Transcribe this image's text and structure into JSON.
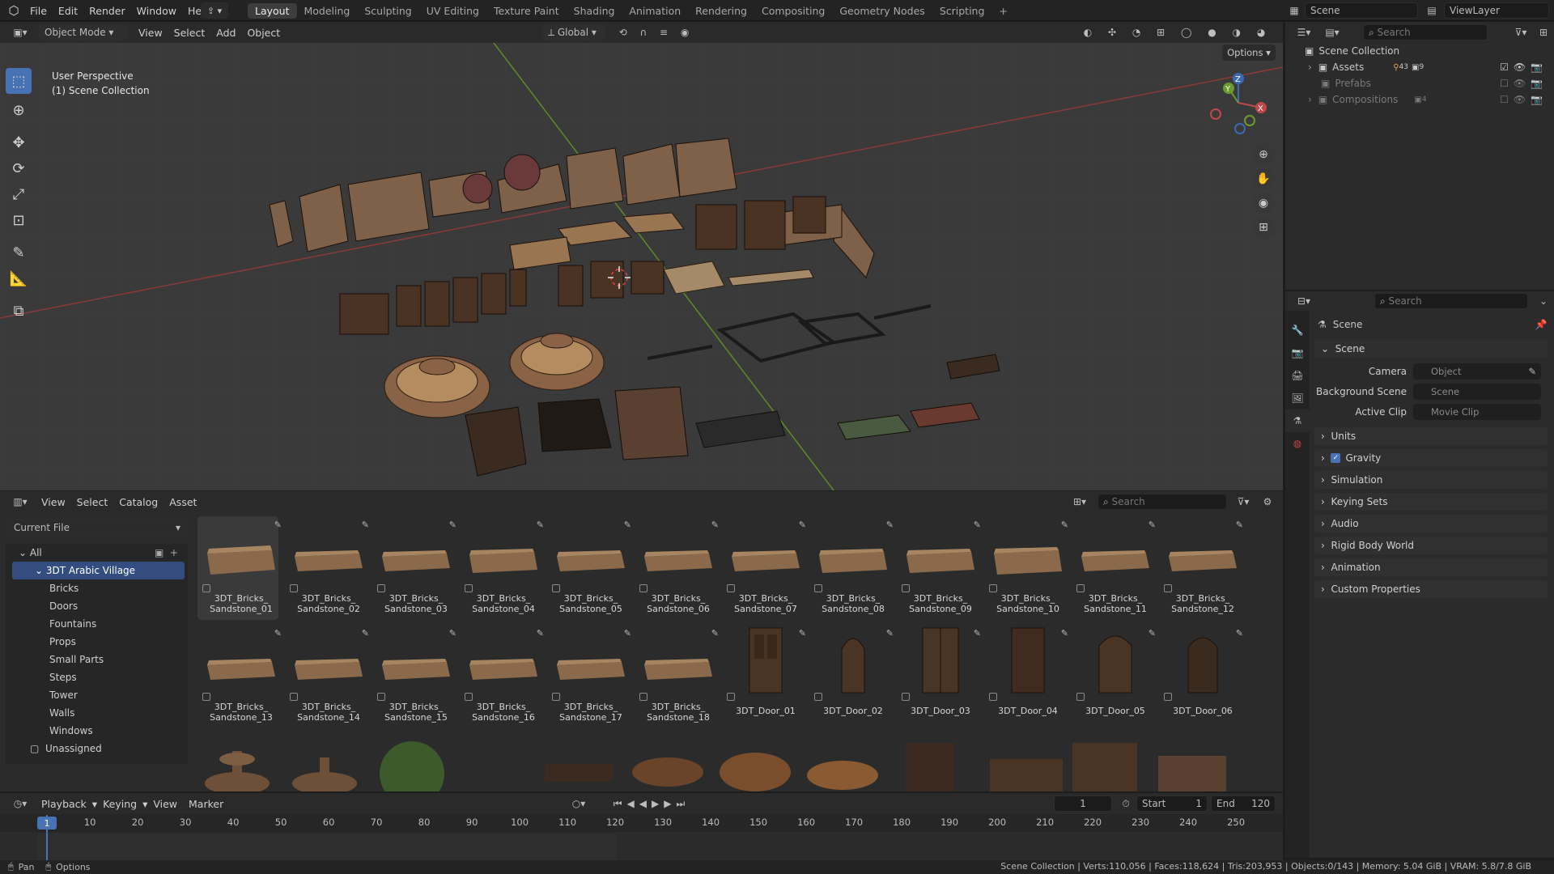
{
  "topbar": {
    "menus": [
      "File",
      "Edit",
      "Render",
      "Window",
      "Help"
    ],
    "workspaces": [
      "Layout",
      "Modeling",
      "Sculpting",
      "UV Editing",
      "Texture Paint",
      "Shading",
      "Animation",
      "Rendering",
      "Compositing",
      "Geometry Nodes",
      "Scripting"
    ],
    "active_workspace": "Layout",
    "scene": "Scene",
    "view_layer": "ViewLayer"
  },
  "viewport_header": {
    "mode": "Object Mode",
    "menus": [
      "View",
      "Select",
      "Add",
      "Object"
    ],
    "orientation": "Global",
    "options": "Options"
  },
  "viewport": {
    "perspective": "User Perspective",
    "collection": "(1) Scene Collection"
  },
  "asset_browser": {
    "menus": [
      "View",
      "Select",
      "Catalog",
      "Asset"
    ],
    "library": "Current File",
    "search_placeholder": "Search",
    "catalog_root": "All",
    "catalog_active": "3DT Arabic Village",
    "catalog_children": [
      "Bricks",
      "Doors",
      "Fountains",
      "Props",
      "Small Parts",
      "Steps",
      "Tower",
      "Walls",
      "Windows"
    ],
    "catalog_unassigned": "Unassigned",
    "assets_row1": [
      "3DT_Bricks_ Sandstone_01",
      "3DT_Bricks_ Sandstone_02",
      "3DT_Bricks_ Sandstone_03",
      "3DT_Bricks_ Sandstone_04",
      "3DT_Bricks_ Sandstone_05",
      "3DT_Bricks_ Sandstone_06",
      "3DT_Bricks_ Sandstone_07",
      "3DT_Bricks_ Sandstone_08",
      "3DT_Bricks_ Sandstone_09",
      "3DT_Bricks_ Sandstone_10",
      "3DT_Bricks_ Sandstone_11",
      "3DT_Bricks_ Sandstone_12"
    ],
    "assets_row2": [
      "3DT_Bricks_ Sandstone_13",
      "3DT_Bricks_ Sandstone_14",
      "3DT_Bricks_ Sandstone_15",
      "3DT_Bricks_ Sandstone_16",
      "3DT_Bricks_ Sandstone_17",
      "3DT_Bricks_ Sandstone_18",
      "3DT_Door_01",
      "3DT_Door_02",
      "3DT_Door_03",
      "3DT_Door_04",
      "3DT_Door_05",
      "3DT_Door_06"
    ]
  },
  "timeline": {
    "menus": [
      "Playback",
      "Keying",
      "View",
      "Marker"
    ],
    "current_frame": "1",
    "start_label": "Start",
    "start": "1",
    "end_label": "End",
    "end": "120",
    "ticks": [
      "1",
      "10",
      "20",
      "30",
      "40",
      "50",
      "60",
      "70",
      "80",
      "90",
      "100",
      "110",
      "120",
      "130",
      "140",
      "150",
      "160",
      "170",
      "180",
      "190",
      "200",
      "210",
      "220",
      "230",
      "240",
      "250"
    ]
  },
  "outliner": {
    "search_placeholder": "Search",
    "root": "Scene Collection",
    "items": [
      "Assets",
      "Prefabs",
      "Compositions"
    ],
    "assets_badge_a": "43",
    "assets_badge_b": "9",
    "compositions_badge": "4"
  },
  "properties": {
    "search_placeholder": "Search",
    "context": "Scene",
    "panel_scene": "Scene",
    "camera_label": "Camera",
    "camera_placeholder": "Object",
    "bg_label": "Background Scene",
    "bg_placeholder": "Scene",
    "clip_label": "Active Clip",
    "clip_placeholder": "Movie Clip",
    "panels": [
      "Units",
      "Gravity",
      "Simulation",
      "Keying Sets",
      "Audio",
      "Rigid Body World",
      "Animation",
      "Custom Properties"
    ]
  },
  "statusbar": {
    "left_a": "Pan",
    "left_b": "Options",
    "stats": "Scene Collection | Verts:110,056 | Faces:118,624 | Tris:203,953 | Objects:0/143 | Memory: 5.04 GiB | VRAM: 5.8/7.8 GiB"
  },
  "colors": {
    "accent": "#4772b3",
    "selection": "#334d80",
    "brick": "#8a6a4b",
    "door": "#4a3424"
  }
}
